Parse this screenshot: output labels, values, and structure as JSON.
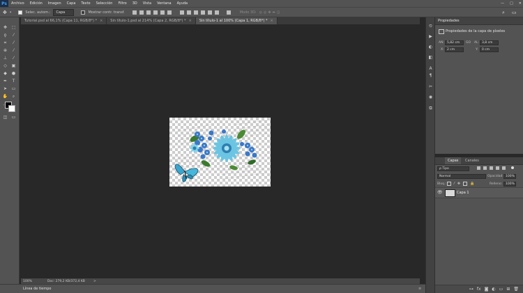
{
  "app": {
    "logo": "Ps"
  },
  "menu": [
    "Archivo",
    "Edición",
    "Imagen",
    "Capa",
    "Texto",
    "Selección",
    "Filtro",
    "3D",
    "Vista",
    "Ventana",
    "Ayuda"
  ],
  "window_controls": [
    "—",
    "□",
    "✕"
  ],
  "options_bar": {
    "auto_select_label": "Selec. autom.:",
    "auto_select_value": "Capa",
    "transform_label": "Mostrar contr. transf.",
    "mode_label": "Modo 3D:"
  },
  "tabs": [
    {
      "label": "Tutorial.psd al 66,1% (Capa 11, RGB/8*) *",
      "close": "×"
    },
    {
      "label": "Sin título-1.psd al 214% (Capa 2, RGB/8*) *",
      "close": "×"
    },
    {
      "label": "Sin título-1 al 100% (Capa 1, RGB/8*) *",
      "close": "×",
      "active": true
    }
  ],
  "status": {
    "zoom": "100%",
    "doc_info": "Doc: 279,2 KB/372,4 KB",
    "arrow": ">"
  },
  "timeline": {
    "label": "Línea de tiempo"
  },
  "properties": {
    "title": "Propiedades",
    "subtitle": "Propiedades de la capa de píxeles",
    "an_label": "AN:",
    "an_value": "5,82 cm",
    "link_label": "GO",
    "al_label": "AL:",
    "al_value": "3,8 cm",
    "x_label": "X:",
    "x_value": "2 cm",
    "y_label": "Y:",
    "y_value": "0 cm"
  },
  "layers": {
    "tabs": [
      "Capas",
      "Canales"
    ],
    "filter_label": "ρ Tipo",
    "blend_mode": "Normal",
    "opacity_label": "Opacidad:",
    "opacity_value": "100%",
    "lock_label": "Bloq.:",
    "fill_label": "Relleno:",
    "fill_value": "100%",
    "layer_name": "Capa 1"
  }
}
